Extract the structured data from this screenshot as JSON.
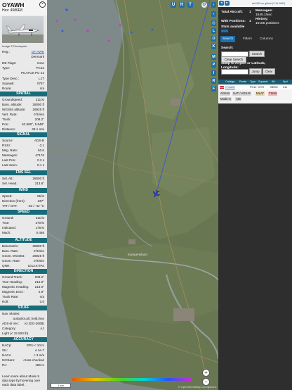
{
  "aircraft": {
    "callsign": "OYAWH",
    "hex_label": "Hex: 4580E8",
    "image_credit": "Image © Rousspoto",
    "reg": {
      "label": "Reg.:",
      "value": "OY-AWH"
    },
    "country": {
      "label": "",
      "value": "Denmark"
    },
    "db_flags": {
      "label": "DB Flags:",
      "value": "none"
    },
    "type": {
      "label": "Type:",
      "value": "PC12"
    },
    "type_full": {
      "label": "",
      "value": "PILATUS PC-12"
    }
  },
  "sections": {
    "spatial": "SPATIAL",
    "signal": "SIGNAL",
    "fms_sel": "FMS SEL",
    "wind": "WIND",
    "speed": "SPEED",
    "altitude": "ALTITUDE",
    "direction": "DIRECTION",
    "stuff": "STUFF",
    "accuracy": "ACCURACY"
  },
  "meta_rows": [
    {
      "label": "Type Desc.:",
      "value": "L1T"
    },
    {
      "label": "Squawk:",
      "value": "0757"
    },
    {
      "label": "Route:",
      "value": "n/a"
    }
  ],
  "spatial_rows": [
    {
      "label": "Groundspeed:",
      "value": "211 kt"
    },
    {
      "label": "Baro. altitude:",
      "value": "28000 ft"
    },
    {
      "label": "WGS84 altitude:",
      "value": "26925 ft"
    },
    {
      "label": "Vert. Rate:",
      "value": "0 ft/min"
    },
    {
      "label": "Track:",
      "value": "209.2°"
    },
    {
      "label": "Pos.:",
      "value": "52.690°, 5.848°"
    },
    {
      "label": "Distance:",
      "value": "29.1 nmi"
    }
  ],
  "signal_rows": [
    {
      "label": "Source:",
      "value": "ADS-B"
    },
    {
      "label": "RSSI:",
      "value": "-3.1"
    },
    {
      "label": "Msg. Rate:",
      "value": "50.6"
    },
    {
      "label": "Messages:",
      "value": "47176"
    },
    {
      "label": "Last Pos.:",
      "value": "0.2 s"
    },
    {
      "label": "Last Seen:",
      "value": "0.1 s"
    }
  ],
  "fms_rows": [
    {
      "label": "Sel. Alt.:",
      "value": "28000 ft"
    },
    {
      "label": "Sel. Head.:",
      "value": "213.8°"
    }
  ],
  "wind_rows": [
    {
      "label": "Speed:",
      "value": "65 kt"
    },
    {
      "label": "Direction (from):",
      "value": "237°"
    },
    {
      "label": "TAT / OAT:",
      "value": "-33 / -42 °C"
    }
  ],
  "speed_rows": [
    {
      "label": "Ground:",
      "value": "211 kt"
    },
    {
      "label": "True:",
      "value": "270 kt"
    },
    {
      "label": "Indicated:",
      "value": "175 kt"
    },
    {
      "label": "Mach:",
      "value": "0.456"
    }
  ],
  "altitude_rows": [
    {
      "label": "Barometric:",
      "value": "28000 ft"
    },
    {
      "label": "Baro. Rate:",
      "value": "0 ft/min"
    },
    {
      "label": "Geom. WGS84:",
      "value": "26925 ft"
    },
    {
      "label": "Geom. Rate:",
      "value": "0 ft/min"
    },
    {
      "label": "QNH:",
      "value": "1013.6 hPa"
    }
  ],
  "direction_rows": [
    {
      "label": "Ground Track:",
      "value": "209.2°"
    },
    {
      "label": "True Heading:",
      "value": "215.9°"
    },
    {
      "label": "Magnetic Heading:",
      "value": "213.0°"
    },
    {
      "label": "Magnetic Decl.:",
      "value": "2.9°"
    },
    {
      "label": "Track Rate:",
      "value": "n/a"
    },
    {
      "label": "Roll:",
      "value": "0.0"
    }
  ],
  "stuff_rows": [
    {
      "label": "Nav. Modes:",
      "value": ""
    },
    {
      "label": "",
      "value": "autopilot,alt_hold,lnav"
    },
    {
      "label": "ADS-B Ver.:",
      "value": "v2 (DO-260B)"
    },
    {
      "label": "Category:",
      "value": "A1"
    },
    {
      "label": "Light (< 15 500 lb)",
      "value": ""
    }
  ],
  "accuracy_rows": [
    {
      "label": "NACp:",
      "value": "EPU < 10 m"
    },
    {
      "label": "SIL:",
      "value": "≤ 1e-7"
    },
    {
      "label": "NACv:",
      "value": "< 3 m/s"
    },
    {
      "label": "NICbaro:",
      "value": "cross-checked"
    },
    {
      "label": "Rc:",
      "value": "186 m"
    }
  ],
  "footer_note": "Learn more about Mode S data type by hovering over each data label.",
  "map": {
    "top_buttons": [
      "U",
      "H",
      "T"
    ],
    "side_buttons": [
      "L",
      "O",
      "K",
      "M",
      "P",
      "I",
      "R",
      "F"
    ],
    "zoom_in": "+",
    "zoom_out": "−",
    "scale_label": "1 km",
    "attribution": "© OpenStreetMap contributors.",
    "place_label": "Kampereiland",
    "colors": {
      "water": "#7f8c8a",
      "land": "#6b7a56",
      "track": "#3a55d8",
      "aircraft": "#2742c9"
    }
  },
  "side": {
    "version_link": "tar1090 on github (3.14.1603)",
    "total_aircraft_label": "Total Aircraft:",
    "total_aircraft": "1",
    "with_positions_label": "With Positions:",
    "with_positions": "1",
    "stats_label": "Stats available",
    "messages_label": "Messages:",
    "messages_rate": "1545.1/sec",
    "history_label": "History:",
    "history_value": "10105 positions",
    "tabs": [
      "Search",
      "Filters",
      "Columns"
    ],
    "search_label": "Search:",
    "search_button": "Search",
    "clear_search_button": "Clear Search",
    "jump_label": "Jump to Airport or Latitude, Longitude:",
    "jump_button": "Jump",
    "clear_button": "Clear",
    "table_headers": [
      "",
      "Callsign",
      "Route",
      "Type",
      "Squawk",
      "Alt.",
      "Spd"
    ],
    "table_row": [
      "",
      "OYAWH",
      "",
      "PC12",
      "0757",
      "28000",
      "211"
    ],
    "chips": [
      "ADS-B",
      "UAT / ADS-R",
      "MLAT",
      "TIS-B",
      "Mode-S",
      "AIS"
    ]
  }
}
